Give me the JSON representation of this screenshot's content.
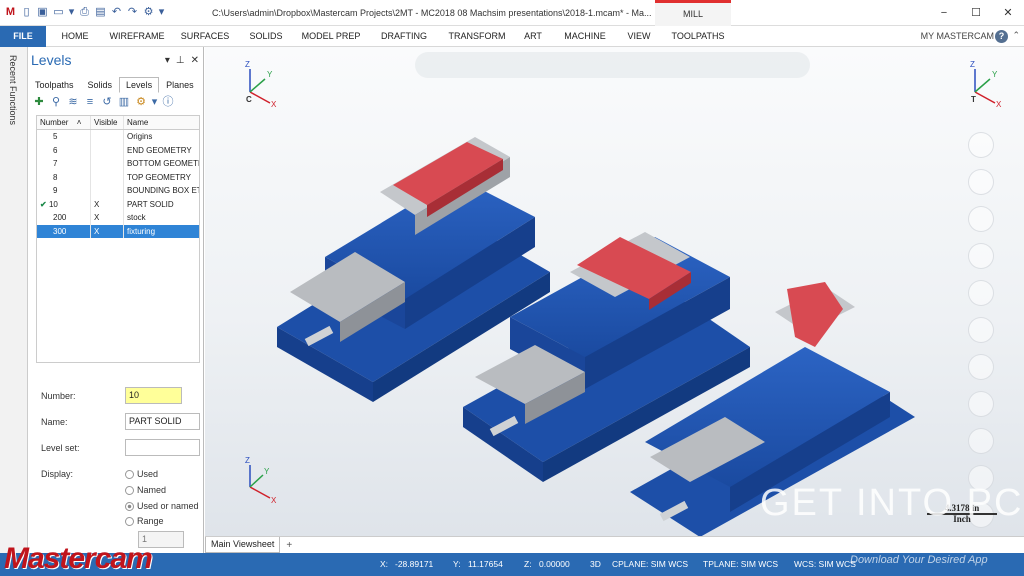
{
  "window": {
    "title": "C:\\Users\\admin\\Dropbox\\Mastercam Projects\\2MT - MC2018 08 Machsim presentations\\2018-1.mcam* - Ma...",
    "context_tab": "MILL",
    "minimize": "−",
    "maximize": "☐",
    "close": "✕"
  },
  "ribbon": {
    "file": "FILE",
    "tabs": [
      "HOME",
      "WIREFRAME",
      "SURFACES",
      "SOLIDS",
      "MODEL PREP",
      "DRAFTING",
      "TRANSFORM",
      "ART",
      "MACHINE",
      "VIEW",
      "TOOLPATHS"
    ],
    "account": "MY MASTERCAM",
    "help": "?"
  },
  "left_strip": {
    "label": "Recent Functions"
  },
  "levels_panel": {
    "title": "Levels",
    "tabs": [
      "Toolpaths",
      "Solids",
      "Levels",
      "Planes"
    ],
    "active_tab": "Levels",
    "columns": {
      "number": "Number",
      "visible": "Visible",
      "name": "Name"
    },
    "rows": [
      {
        "number": "5",
        "visible": "",
        "name": "Origins"
      },
      {
        "number": "6",
        "visible": "",
        "name": "END GEOMETRY"
      },
      {
        "number": "7",
        "visible": "",
        "name": "BOTTOM GEOMETR"
      },
      {
        "number": "8",
        "visible": "",
        "name": "TOP GEOMETRY"
      },
      {
        "number": "9",
        "visible": "",
        "name": "BOUNDING BOX ET"
      },
      {
        "number": "10",
        "visible": "X",
        "name": "PART SOLID",
        "current": true
      },
      {
        "number": "200",
        "visible": "X",
        "name": "stock"
      },
      {
        "number": "300",
        "visible": "X",
        "name": "fixturing",
        "selected": true
      }
    ],
    "form": {
      "number_label": "Number:",
      "number_value": "10",
      "name_label": "Name:",
      "name_value": "PART SOLID",
      "level_set_label": "Level set:",
      "level_set_value": "",
      "display_label": "Display:",
      "display_options": [
        "Used",
        "Named",
        "Used or named",
        "Range"
      ],
      "display_selected": "Used or named",
      "range_value": "1"
    }
  },
  "viewport": {
    "tab": "Main Viewsheet",
    "add_tab": "+",
    "gnomon_top_left": "C",
    "gnomon_top_right": "T",
    "scale_value": "4.3178 in",
    "scale_unit": "Inch",
    "watermark": "GET INTO PC",
    "watermark_sub": "Download Your Desired App"
  },
  "status_bar": {
    "x_label": "X:",
    "x_value": "-28.89171",
    "y_label": "Y:",
    "y_value": "11.17654",
    "z_label": "Z:",
    "z_value": "0.00000",
    "mode": "3D",
    "cplane": "CPLANE: SIM WCS",
    "tplane": "TPLANE: SIM WCS",
    "wcs": "WCS: SIM WCS"
  },
  "brand": {
    "logo": "Mastercam"
  },
  "colors": {
    "accent": "#2a6ab3",
    "vise_blue": "#1d4fa8",
    "part_red": "#d84a52",
    "jaw_gray": "#b9bcc0"
  }
}
